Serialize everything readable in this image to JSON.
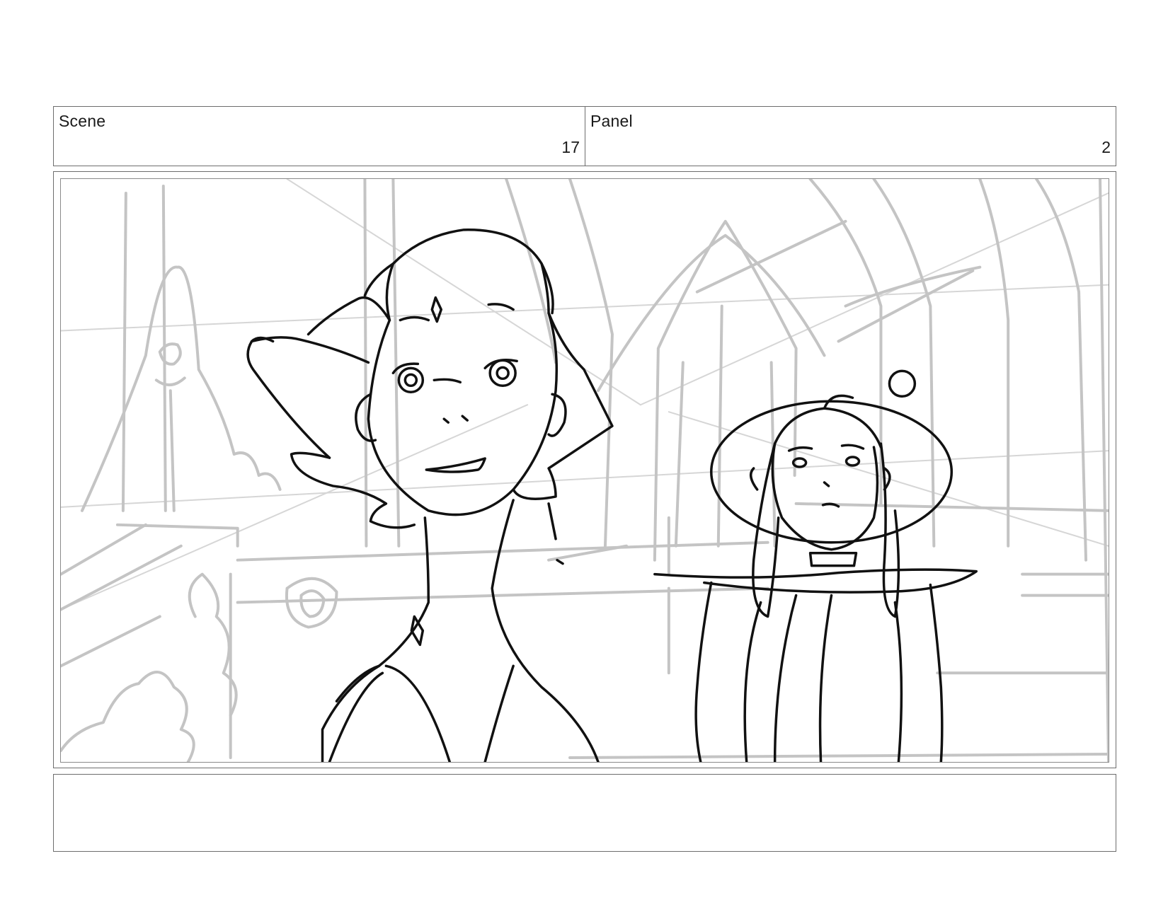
{
  "header": {
    "scene_label": "Scene",
    "scene_number": "17",
    "panel_label": "Panel",
    "panel_number": "2"
  },
  "notes": {
    "text": ""
  }
}
